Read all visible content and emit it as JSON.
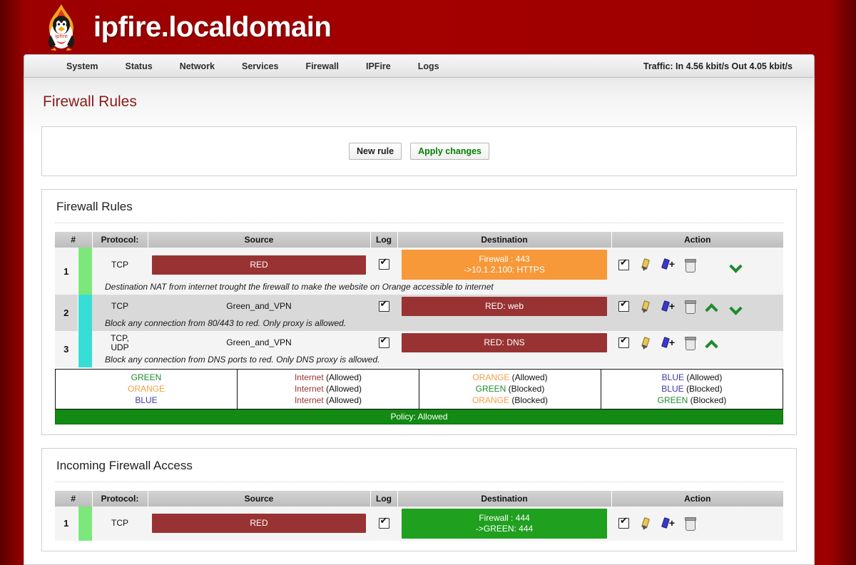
{
  "header": {
    "site_title": "ipfire.localdomain",
    "logo_icon": "ipfire-penguin-flame-logo"
  },
  "nav": {
    "items": [
      {
        "label": "System"
      },
      {
        "label": "Status"
      },
      {
        "label": "Network"
      },
      {
        "label": "Services"
      },
      {
        "label": "Firewall"
      },
      {
        "label": "IPFire"
      },
      {
        "label": "Logs"
      }
    ],
    "traffic": "Traffic: In 4.56 kbit/s   Out 4.05 kbit/s"
  },
  "page": {
    "title": "Firewall Rules"
  },
  "actionbar": {
    "new_rule": "New rule",
    "apply_changes": "Apply changes"
  },
  "rules_panel": {
    "title": "Firewall Rules",
    "columns": [
      "#",
      "Protocol:",
      "Source",
      "Log",
      "Destination",
      "Action"
    ],
    "rows": [
      {
        "num": "1",
        "bar_color": "#7ce87c",
        "protocol": "TCP",
        "source": "RED",
        "source_style": "red",
        "log": true,
        "destination": "Firewall : 443\n->10.1.2.100: HTTPS",
        "destination_line1": "Firewall : 443",
        "destination_line2": "->10.1.2.100: HTTPS",
        "destination_style": "orange",
        "enabled": true,
        "remark": "Destination NAT from internet trought the firewall to make the website on Orange accessible to internet",
        "move_up": false,
        "move_down": true
      },
      {
        "num": "2",
        "bar_color": "#36ded6",
        "protocol": "TCP",
        "source": "Green_and_VPN",
        "source_style": "plain",
        "log": true,
        "destination_line1": "RED: web",
        "destination_line2": "",
        "destination_style": "red",
        "enabled": true,
        "remark": "Block any connection from 80/443 to red. Only proxy is allowed.",
        "move_up": true,
        "move_down": true
      },
      {
        "num": "3",
        "bar_color": "#36ded6",
        "protocol": "TCP,\nUDP",
        "protocol_line1": "TCP,",
        "protocol_line2": "UDP",
        "source": "Green_and_VPN",
        "source_style": "plain",
        "log": true,
        "destination_line1": "RED: DNS",
        "destination_line2": "",
        "destination_style": "red",
        "enabled": true,
        "remark": "Block any connection from DNS ports to red. Only DNS proxy is allowed.",
        "move_up": true,
        "move_down": false
      }
    ],
    "legend": {
      "col1": [
        {
          "zone": "GREEN",
          "zone_class": "lg-green",
          "status": ""
        },
        {
          "zone": "ORANGE",
          "zone_class": "lg-orange",
          "status": ""
        },
        {
          "zone": "BLUE",
          "zone_class": "lg-blue",
          "status": ""
        }
      ],
      "col2": [
        {
          "zone": "Internet",
          "zone_class": "lg-red",
          "status": " (Allowed)"
        },
        {
          "zone": "Internet",
          "zone_class": "lg-red",
          "status": " (Allowed)"
        },
        {
          "zone": "Internet",
          "zone_class": "lg-red",
          "status": " (Allowed)"
        }
      ],
      "col3": [
        {
          "zone": "ORANGE",
          "zone_class": "lg-orange",
          "status": " (Allowed)"
        },
        {
          "zone": "GREEN",
          "zone_class": "lg-green",
          "status": " (Blocked)"
        },
        {
          "zone": "ORANGE",
          "zone_class": "lg-orange",
          "status": " (Blocked)"
        }
      ],
      "col4": [
        {
          "zone": "BLUE",
          "zone_class": "lg-blue",
          "status": " (Allowed)"
        },
        {
          "zone": "BLUE",
          "zone_class": "lg-blue",
          "status": " (Blocked)"
        },
        {
          "zone": "GREEN",
          "zone_class": "lg-green",
          "status": " (Blocked)"
        }
      ]
    },
    "policy": "Policy: Allowed"
  },
  "incoming_panel": {
    "title": "Incoming Firewall Access",
    "columns": [
      "#",
      "Protocol:",
      "Source",
      "Log",
      "Destination",
      "Action"
    ],
    "rows": [
      {
        "num": "1",
        "bar_color": "#7ce87c",
        "protocol": "TCP",
        "source": "RED",
        "source_style": "red",
        "log": true,
        "destination_line1": "Firewall : 444",
        "destination_line2": "->GREEN: 444",
        "destination_style": "green",
        "enabled": true
      }
    ]
  },
  "colors": {
    "brand_red": "#a30000",
    "title_red": "#8b1a1a",
    "tag_red": "#993333",
    "tag_orange": "#f79839",
    "tag_green": "#1fa01f",
    "policy_green": "#138a13",
    "apply_green": "#008000",
    "bar_green": "#7ce87c",
    "bar_cyan": "#36ded6"
  }
}
